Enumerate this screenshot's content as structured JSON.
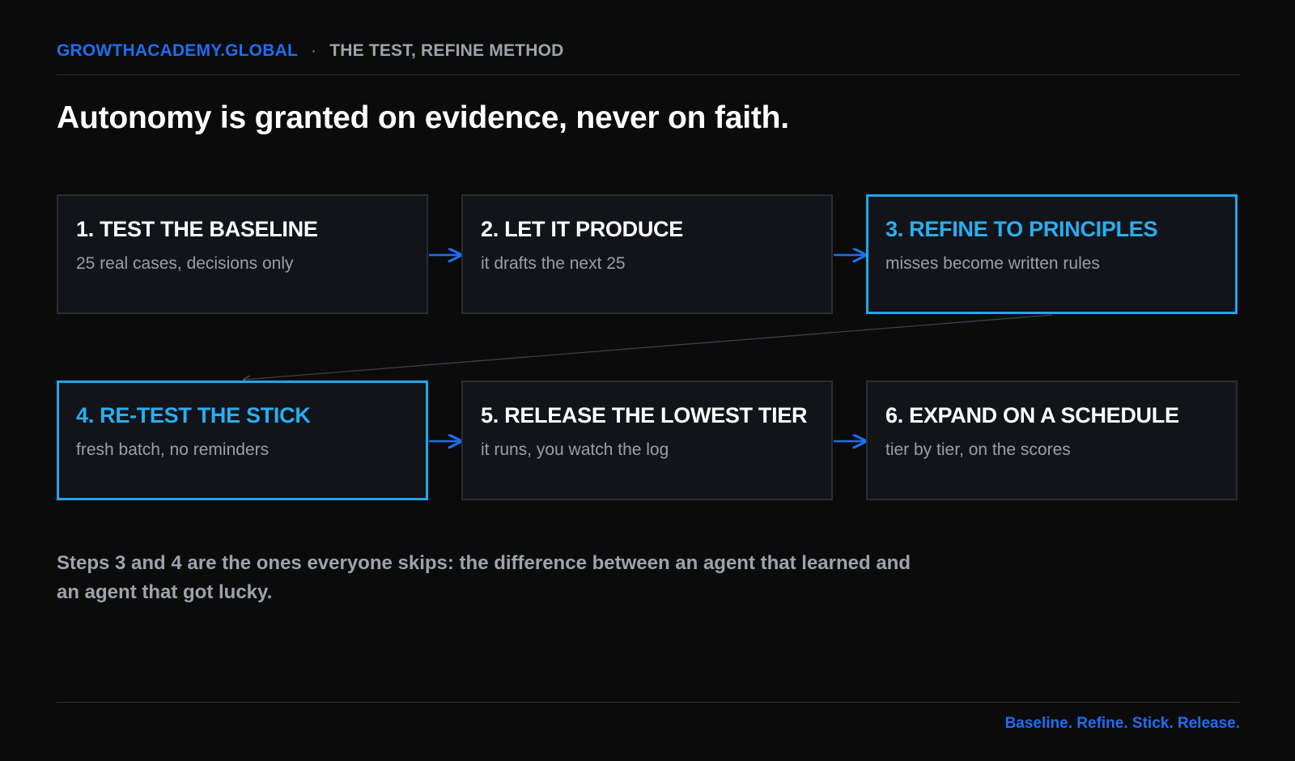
{
  "header": {
    "brand": "GROWTHACADEMY.GLOBAL",
    "separator": "·",
    "subtitle": "THE TEST, REFINE METHOD"
  },
  "headline": "Autonomy is granted on evidence, never on faith.",
  "steps": [
    {
      "title": "1. TEST THE BASELINE",
      "description": "25 real cases, decisions only",
      "highlighted": false
    },
    {
      "title": "2. LET IT PRODUCE",
      "description": "it drafts the next 25",
      "highlighted": false
    },
    {
      "title": "3. REFINE TO PRINCIPLES",
      "description": "misses become written rules",
      "highlighted": true
    },
    {
      "title": "4. RE-TEST THE STICK",
      "description": "fresh batch, no reminders",
      "highlighted": true
    },
    {
      "title": "5. RELEASE THE LOWEST TIER",
      "description": "it runs, you watch the log",
      "highlighted": false
    },
    {
      "title": "6. EXPAND ON A SCHEDULE",
      "description": "tier by tier, on the scores",
      "highlighted": false
    }
  ],
  "footnote": "Steps 3 and 4 are the ones everyone skips: the difference between an agent that learned and an agent that got lucky.",
  "tagline": "Baseline. Refine. Stick. Release.",
  "colors": {
    "brand": "#1e6ef0",
    "highlight": "#1fa7ea",
    "arrow": "#1e6ef0",
    "background": "#0b0b0c",
    "card": "#12141a"
  }
}
